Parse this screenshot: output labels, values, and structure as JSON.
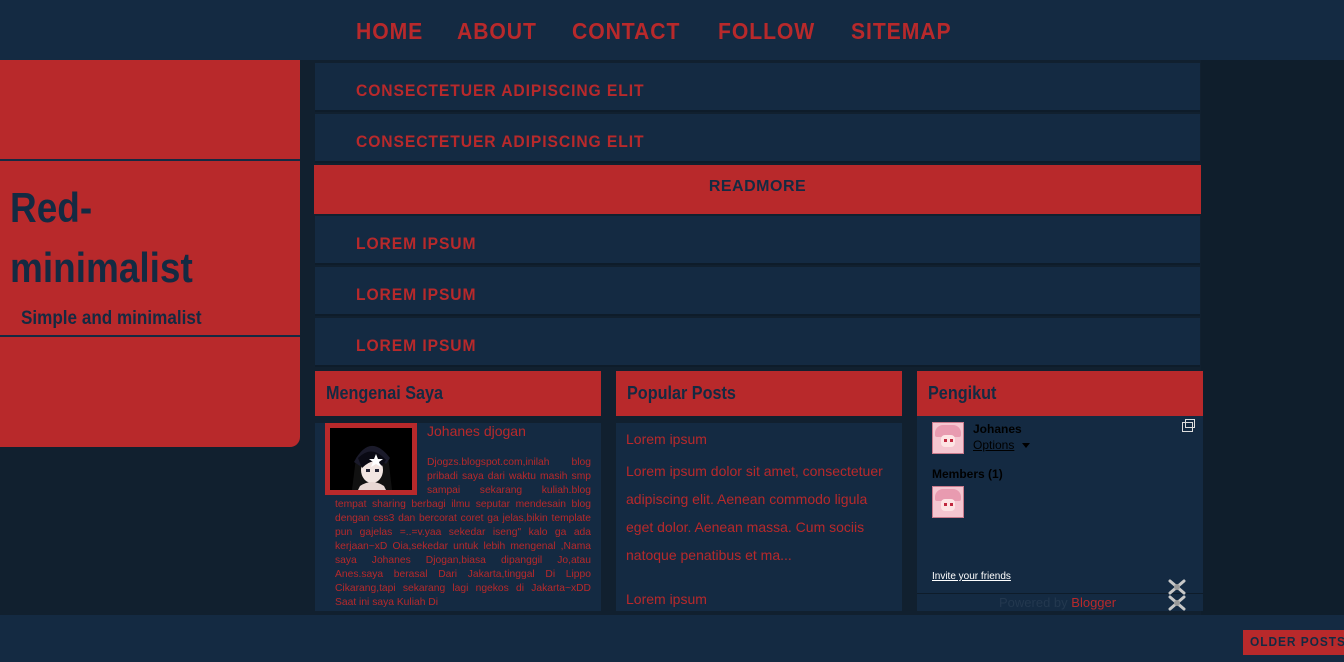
{
  "nav": {
    "items": [
      "HOME",
      "ABOUT",
      "CONTACT",
      "FOLLOW",
      "SITEMAP"
    ]
  },
  "header": {
    "title": "Red-minimalist",
    "description": "Simple and minimalist"
  },
  "posts": {
    "items": [
      "CONSECTETUER ADIPISCING ELIT",
      "CONSECTETUER ADIPISCING ELIT",
      "LOREM IPSUM",
      "LOREM IPSUM",
      "LOREM IPSUM"
    ],
    "readmore": "READMORE"
  },
  "about": {
    "title": "Mengenai Saya",
    "name": "Johanes djogan",
    "text": "Djogzs.blogspot.com,inilah blog pribadi saya dari waktu masih smp sampai sekarang kuliah.blog tempat sharing berbagi ilmu seputar mendesain blog dengan css3 dan bercorat coret ga jelas,bikin template pun gajelas =..=v.yaa sekedar iseng\" kalo ga ada kerjaan~xD Oia,sekedar untuk lebih mengenal ,Nama saya Johanes Djogan,biasa dipanggil Jo,atau Anes.saya berasal Dari Jakarta,tinggal Di Lippo Cikarang,tapi sekarang lagi ngekos di Jakarta~xDD Saat ini saya Kuliah Di"
  },
  "popular": {
    "title": "Popular Posts",
    "post1_title": "Lorem ipsum",
    "post1_snippet": "Lorem ipsum dolor sit amet, consectetuer adipiscing elit. Aenean commodo ligula eget dolor. Aenean massa. Cum sociis natoque penatibus et ma...",
    "post2_title": "Lorem ipsum"
  },
  "followers": {
    "title": "Pengikut",
    "user": "Johanes",
    "options": "Options",
    "members": "Members (1)",
    "invite": "Invite your friends",
    "powered_prefix": "Powered by",
    "powered_link": "Blogger"
  },
  "footer": {
    "older_posts": "OLDER POSTS"
  },
  "colors": {
    "accent_red": "#b8292b",
    "navy": "#142a42",
    "background": "#11202f"
  }
}
